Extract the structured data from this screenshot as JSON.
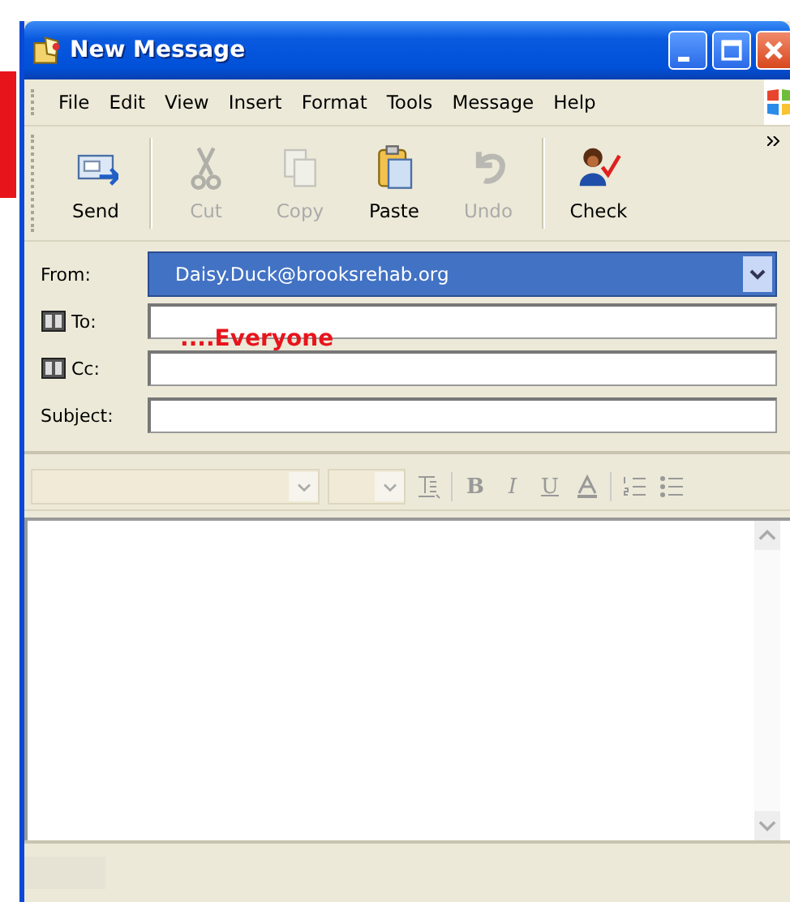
{
  "window": {
    "title": "New Message"
  },
  "menu": [
    "File",
    "Edit",
    "View",
    "Insert",
    "Format",
    "Tools",
    "Message",
    "Help"
  ],
  "toolbar": [
    {
      "label": "Send",
      "kind": "send",
      "disabled": false
    },
    {
      "label": "Cut",
      "kind": "cut",
      "disabled": true
    },
    {
      "label": "Copy",
      "kind": "copy",
      "disabled": true
    },
    {
      "label": "Paste",
      "kind": "paste",
      "disabled": false
    },
    {
      "label": "Undo",
      "kind": "undo",
      "disabled": true
    },
    {
      "label": "Check",
      "kind": "check",
      "disabled": false
    }
  ],
  "header": [
    {
      "label": "From:",
      "kind": "select",
      "value": "Daisy.Duck@brooksrehab.org"
    },
    {
      "label": "To:",
      "kind": "address"
    },
    {
      "label": "Cc:",
      "kind": "address"
    },
    {
      "label": "Subject:",
      "kind": "text"
    }
  ],
  "annotation": "....Everyone",
  "format_bar": {
    "bold": "B",
    "italic": "I",
    "underline": "U"
  }
}
